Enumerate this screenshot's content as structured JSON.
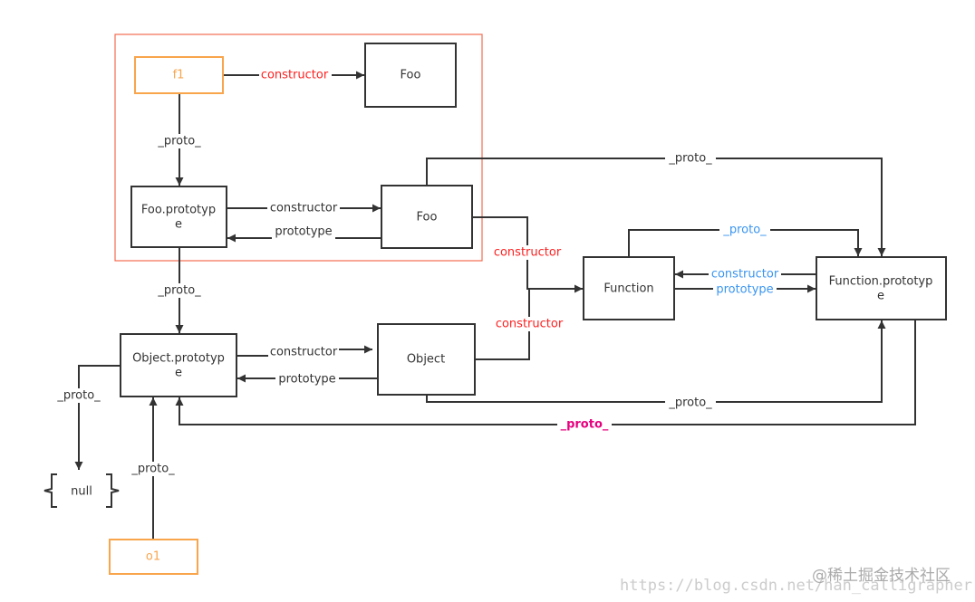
{
  "nodes": {
    "f1": "f1",
    "foo_top": "Foo",
    "foo_prototype_l1": "Foo.prototyp",
    "foo_prototype_l2": "e",
    "foo": "Foo",
    "function": "Function",
    "function_prototype_l1": "Function.prototyp",
    "function_prototype_l2": "e",
    "object_prototype_l1": "Object.prototyp",
    "object_prototype_l2": "e",
    "object": "Object",
    "null": "null",
    "o1": "o1"
  },
  "edges": {
    "f1_constructor": "constructor",
    "f1_proto": "_proto_",
    "fooproto_constructor": "constructor",
    "foo_prototype": "prototype",
    "foo_proto": "_proto_",
    "foo_constructor": "constructor",
    "object_constructor": "constructor",
    "function_proto": "_proto_",
    "functionproto_constructor": "constructor",
    "function_prototype": "prototype",
    "fooproto_proto": "_proto_",
    "objectproto_constructor": "constructor",
    "object_prototype": "prototype",
    "object_proto": "_proto_",
    "functionproto_proto": "_proto_",
    "objectproto_proto": "_proto_",
    "o1_proto": "_proto_"
  },
  "colors": {
    "instance_border": "#f8a54c",
    "highlight_frame": "#f26b4f",
    "red_label": "#ff2020",
    "blue_label": "#3a95f0",
    "pink_label": "#e6007e",
    "line": "#333333"
  },
  "watermark": {
    "url": "https://blog.csdn.net/han_calligrapher",
    "site": "@稀土掘金技术社区"
  }
}
